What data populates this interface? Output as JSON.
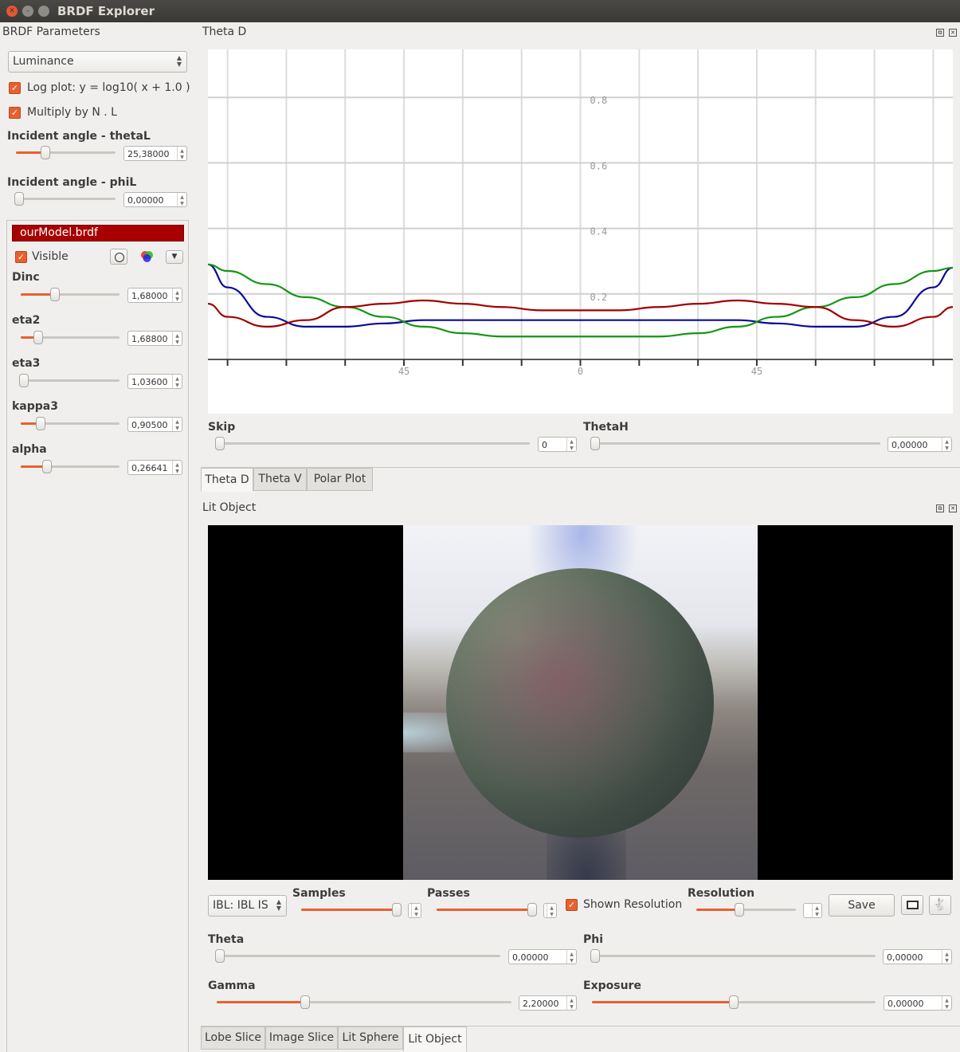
{
  "window": {
    "title": "BRDF Explorer"
  },
  "left": {
    "header": "BRDF Parameters",
    "mode_combo": "Luminance",
    "log_plot": {
      "label": "Log plot:  y = log10( x + 1.0 )",
      "checked": true
    },
    "multiply": {
      "label": "Multiply by N . L",
      "checked": true
    },
    "theta_l": {
      "label": "Incident angle - thetaL",
      "value": "25,38000"
    },
    "phi_l": {
      "label": "Incident angle - phiL",
      "value": "0,00000"
    },
    "brdf": {
      "name": "ourModel.brdf",
      "visible_label": "Visible",
      "params": [
        {
          "label": "Dinc",
          "value": "1,68000",
          "level": 0.35
        },
        {
          "label": "eta2",
          "value": "1,68800",
          "level": 0.18
        },
        {
          "label": "eta3",
          "value": "1,03600",
          "level": 0.03
        },
        {
          "label": "kappa3",
          "value": "0,90500",
          "level": 0.2
        },
        {
          "label": "alpha",
          "value": "0,26641",
          "level": 0.27
        }
      ]
    }
  },
  "plot_panel": {
    "title": "Theta D",
    "skip": {
      "label": "Skip",
      "value": "0"
    },
    "thetah": {
      "label": "ThetaH",
      "value": "0,00000"
    },
    "tabs": [
      "Theta D",
      "Theta V",
      "Polar Plot"
    ],
    "active_tab": 0
  },
  "chart_data": {
    "type": "line",
    "x_tick_labels": [
      "45",
      "0",
      "45"
    ],
    "y_tick_labels": [
      "0.8",
      "0.6",
      "0.4",
      "0.2"
    ],
    "ylim": [
      0,
      0.95
    ],
    "x_range": [
      -95,
      95
    ],
    "grid": true,
    "series": [
      {
        "color": "#0a0a96",
        "x": [
          -95,
          -90,
          -80,
          -70,
          -60,
          -50,
          -40,
          -30,
          -20,
          -10,
          0,
          10,
          20,
          30,
          40,
          50,
          60,
          70,
          80,
          90,
          95
        ],
        "y": [
          0.29,
          0.22,
          0.13,
          0.1,
          0.1,
          0.11,
          0.12,
          0.12,
          0.12,
          0.12,
          0.12,
          0.12,
          0.12,
          0.12,
          0.12,
          0.11,
          0.1,
          0.1,
          0.13,
          0.22,
          0.28
        ]
      },
      {
        "color": "#149614",
        "x": [
          -95,
          -90,
          -80,
          -70,
          -60,
          -50,
          -40,
          -30,
          -20,
          -10,
          0,
          10,
          20,
          30,
          40,
          50,
          60,
          70,
          80,
          90,
          95
        ],
        "y": [
          0.29,
          0.27,
          0.23,
          0.19,
          0.16,
          0.13,
          0.1,
          0.08,
          0.07,
          0.07,
          0.07,
          0.07,
          0.07,
          0.08,
          0.1,
          0.13,
          0.16,
          0.19,
          0.23,
          0.27,
          0.28
        ]
      },
      {
        "color": "#a00000",
        "x": [
          -95,
          -90,
          -80,
          -70,
          -60,
          -50,
          -40,
          -30,
          -20,
          -10,
          0,
          10,
          20,
          30,
          40,
          50,
          60,
          70,
          80,
          90,
          95
        ],
        "y": [
          0.17,
          0.13,
          0.1,
          0.12,
          0.16,
          0.17,
          0.18,
          0.17,
          0.16,
          0.15,
          0.15,
          0.15,
          0.16,
          0.17,
          0.18,
          0.17,
          0.16,
          0.12,
          0.1,
          0.13,
          0.16
        ]
      }
    ]
  },
  "object_panel": {
    "title": "Lit Object",
    "ibl_combo": "IBL: IBL IS",
    "samples_label": "Samples",
    "passes_label": "Passes",
    "shown_resolution": {
      "label": "Shown Resolution",
      "checked": true
    },
    "resolution_label": "Resolution",
    "save_label": "Save",
    "theta": {
      "label": "Theta",
      "value": "0,00000"
    },
    "phi": {
      "label": "Phi",
      "value": "0,00000"
    },
    "gamma": {
      "label": "Gamma",
      "value": "2,20000",
      "level": 0.3
    },
    "exposure": {
      "label": "Exposure",
      "value": "0,00000",
      "level": 0.5
    },
    "tabs": [
      "Lobe Slice",
      "Image Slice",
      "Lit Sphere",
      "Lit Object"
    ],
    "active_tab": 3
  },
  "icons": [
    "close-icon",
    "minimize-icon",
    "undock-icon",
    "dock-close-icon",
    "circle-icon",
    "color-wheel-icon",
    "dropdown-arrow-icon",
    "image-icon",
    "bunny-icon"
  ]
}
